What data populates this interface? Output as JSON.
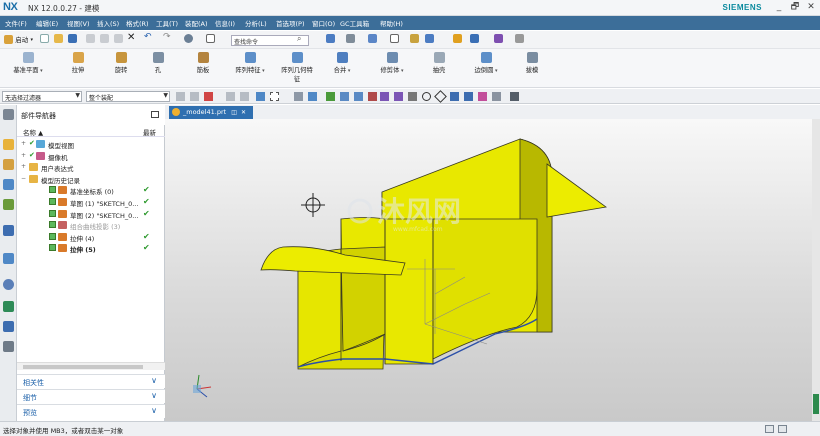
{
  "window": {
    "logo": "NX",
    "title": "NX 12.0.0.27 - 建模",
    "brand": "SIEMENS",
    "controls": [
      "_",
      "🗗",
      "✕"
    ]
  },
  "menu": [
    "文件(F)",
    "编辑(E)",
    "视图(V)",
    "插入(S)",
    "格式(R)",
    "工具(T)",
    "装配(A)",
    "信息(I)",
    "分析(L)",
    "首选项(P)",
    "窗口(O)",
    "GC工具箱",
    "帮助(H)"
  ],
  "toolbar": {
    "start_label": "启动",
    "command_search_placeholder": "查找命令"
  },
  "ribbon": [
    {
      "label": "基准平面",
      "has_arrow": true
    },
    {
      "label": "拉伸",
      "has_arrow": false
    },
    {
      "label": "旋转",
      "has_arrow": false
    },
    {
      "label": "孔",
      "has_arrow": false
    },
    {
      "label": "筋板",
      "has_arrow": false
    },
    {
      "label": "阵列特征",
      "has_arrow": true
    },
    {
      "label": "阵列几何特",
      "label2": "征",
      "has_arrow": false
    },
    {
      "label": "合并",
      "has_arrow": true
    },
    {
      "label": "修剪体",
      "has_arrow": true
    },
    {
      "label": "抽壳",
      "has_arrow": false
    },
    {
      "label": "边倒圆",
      "has_arrow": true
    },
    {
      "label": "拔模",
      "has_arrow": false
    }
  ],
  "selection": {
    "type_filter": "无选择过滤器",
    "scope": "整个装配"
  },
  "navigator": {
    "title": "部件导航器",
    "columns": {
      "name": "名称",
      "latest": "最新"
    },
    "tree": [
      {
        "label": "模型视图",
        "level": 0,
        "expander": "+",
        "checkbox": false,
        "latest": false,
        "greyed": false,
        "bold": false
      },
      {
        "label": "摄像机",
        "level": 0,
        "expander": "+",
        "checkbox": false,
        "latest": false,
        "greyed": false,
        "bold": false
      },
      {
        "label": "用户表达式",
        "level": 0,
        "expander": "+",
        "checkbox": false,
        "latest": false,
        "greyed": false,
        "bold": false
      },
      {
        "label": "模型历史记录",
        "level": 0,
        "expander": "−",
        "checkbox": false,
        "latest": false,
        "greyed": false,
        "bold": false
      },
      {
        "label": "基准坐标系 (0)",
        "level": 1,
        "expander": "",
        "checkbox": true,
        "latest": true,
        "greyed": false,
        "bold": false
      },
      {
        "label": "草图 (1) \"SKETCH_0...",
        "level": 1,
        "expander": "",
        "checkbox": true,
        "latest": true,
        "greyed": false,
        "bold": false
      },
      {
        "label": "草图 (2) \"SKETCH_0...",
        "level": 1,
        "expander": "",
        "checkbox": true,
        "latest": true,
        "greyed": false,
        "bold": false
      },
      {
        "label": "组合曲线投影 (3)",
        "level": 1,
        "expander": "",
        "checkbox": true,
        "latest": false,
        "greyed": true,
        "bold": false
      },
      {
        "label": "拉伸 (4)",
        "level": 1,
        "expander": "",
        "checkbox": true,
        "latest": true,
        "greyed": false,
        "bold": false
      },
      {
        "label": "拉伸 (5)",
        "level": 1,
        "expander": "",
        "checkbox": true,
        "latest": true,
        "greyed": false,
        "bold": true
      }
    ],
    "panels": [
      "相关性",
      "细节",
      "预览"
    ]
  },
  "document_tab": {
    "label": "_model41.prt",
    "close": "✕"
  },
  "watermark": {
    "text": "沐风网",
    "url": "www.mfcad.com"
  },
  "status": {
    "text": "选择对象并使用 MB3，或者双击某一对象"
  },
  "colors": {
    "menu_bar": "#3c6e99",
    "brand": "#0a8a9e",
    "model_face": "#e6e600",
    "model_edge": "#3a3a20",
    "check_green": "#2e9a2e",
    "panel_text": "#1a5fa8"
  }
}
